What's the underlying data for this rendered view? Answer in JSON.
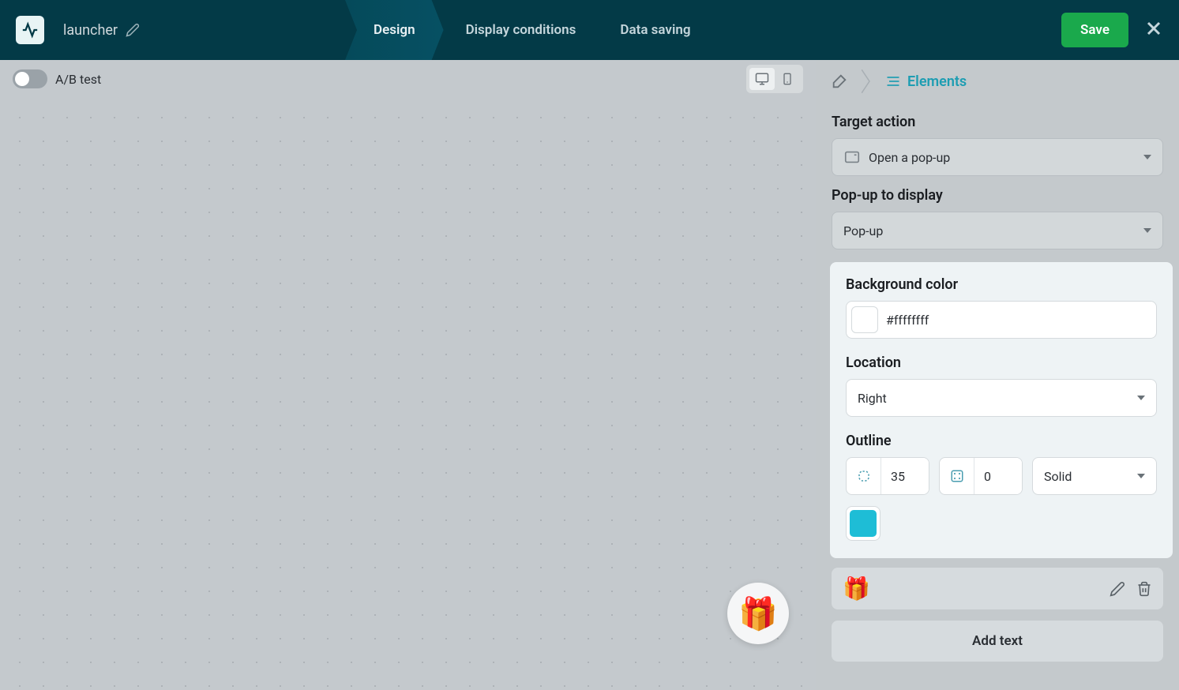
{
  "header": {
    "launcher_name": "launcher",
    "tabs": {
      "design": "Design",
      "display_conditions": "Display conditions",
      "data_saving": "Data saving"
    },
    "save_label": "Save"
  },
  "canvas": {
    "ab_test_label": "A/B test"
  },
  "panel": {
    "tab_elements_label": "Elements",
    "target_action": {
      "label": "Target action",
      "value": "Open a pop-up"
    },
    "popup_to_display": {
      "label": "Pop-up to display",
      "value": "Pop-up"
    },
    "background_color": {
      "label": "Background color",
      "value": "#ffffffff"
    },
    "location": {
      "label": "Location",
      "value": "Right"
    },
    "outline": {
      "label": "Outline",
      "radius": "35",
      "width": "0",
      "style": "Solid",
      "color": "#1ebdd6"
    },
    "add_text_label": "Add text"
  }
}
